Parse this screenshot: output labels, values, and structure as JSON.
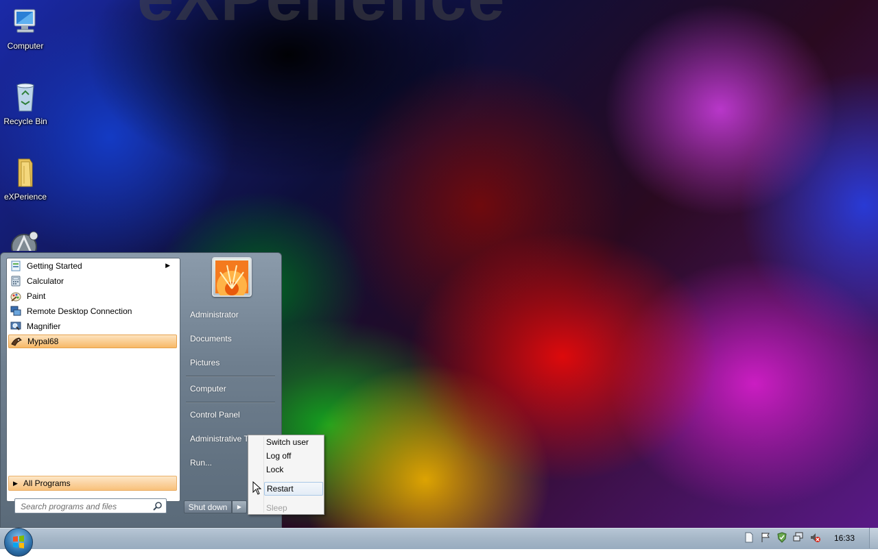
{
  "desktop": {
    "watermark": "eXPerience",
    "icons": [
      {
        "label": "Computer",
        "icon": "computer-icon"
      },
      {
        "label": "Recycle Bin",
        "icon": "recycle-bin-icon"
      },
      {
        "label": "eXPerience",
        "icon": "folder-icon"
      },
      {
        "label": "",
        "icon": "app-shortcut-icon"
      }
    ]
  },
  "start_menu": {
    "programs": [
      {
        "label": "Getting Started",
        "icon": "getting-started-icon",
        "has_submenu": true
      },
      {
        "label": "Calculator",
        "icon": "calculator-icon"
      },
      {
        "label": "Paint",
        "icon": "paint-icon"
      },
      {
        "label": "Remote Desktop Connection",
        "icon": "remote-desktop-icon"
      },
      {
        "label": "Magnifier",
        "icon": "magnifier-icon"
      },
      {
        "label": "Mypal68",
        "icon": "mypal-icon",
        "selected": true
      }
    ],
    "all_programs": "All Programs",
    "search_placeholder": "Search programs and files",
    "right_links": {
      "administrator": "Administrator",
      "documents": "Documents",
      "pictures": "Pictures",
      "computer": "Computer",
      "control_panel": "Control Panel",
      "administrative_tools": "Administrative Tools",
      "run": "Run..."
    },
    "shutdown_label": "Shut down"
  },
  "power_menu": {
    "items": [
      "Switch user",
      "Log off",
      "Lock",
      "Restart",
      "Sleep"
    ],
    "hovered": "Restart",
    "disabled": [
      "Sleep"
    ]
  },
  "taskbar": {
    "clock": "16:33",
    "tray_icons": [
      "document-icon",
      "action-center-flag-icon",
      "security-shield-icon",
      "network-icon",
      "volume-muted-icon"
    ]
  },
  "colors": {
    "selection_orange": "#f7b867",
    "start_menu_gray": "#6f7f8f",
    "taskbar_blue": "#a5b6c7"
  }
}
